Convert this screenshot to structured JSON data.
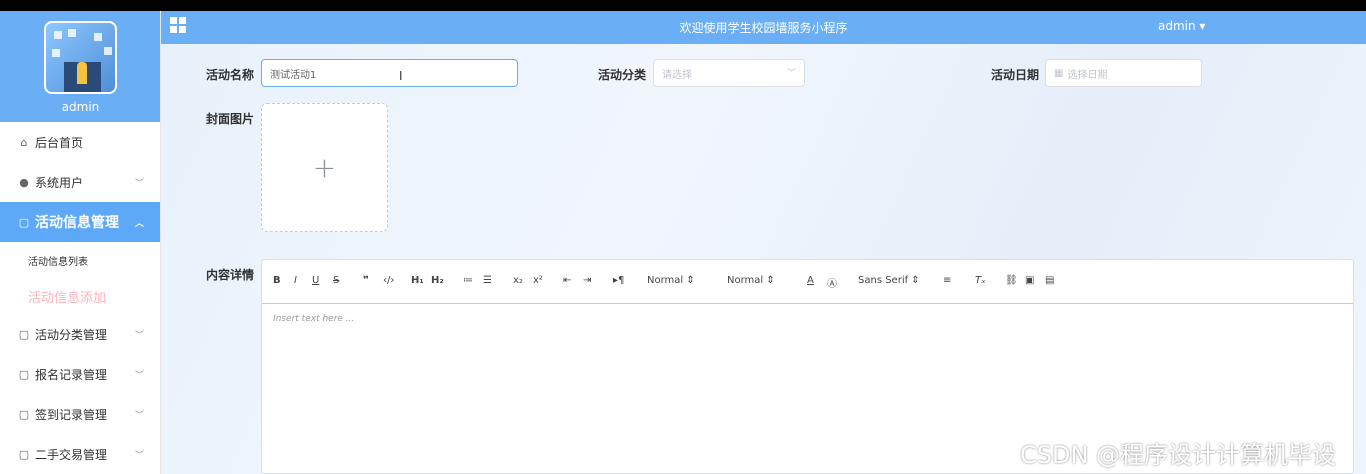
{
  "header": {
    "title": "欢迎使用学生校园墙服务小程序",
    "admin": "admin ▾"
  },
  "profile": {
    "name": "admin"
  },
  "sidebar": {
    "items": [
      {
        "label": "后台首页",
        "icon": "home-icon"
      },
      {
        "label": "系统用户",
        "icon": "user-icon"
      },
      {
        "label": "活动信息管理",
        "icon": "doc-icon",
        "active": true
      },
      {
        "label": "活动分类管理",
        "icon": "doc-icon"
      },
      {
        "label": "报名记录管理",
        "icon": "doc-icon"
      },
      {
        "label": "签到记录管理",
        "icon": "doc-icon"
      },
      {
        "label": "二手交易管理",
        "icon": "doc-icon"
      }
    ],
    "subitems": [
      {
        "label": "活动信息列表"
      },
      {
        "label": "活动信息添加",
        "current": true
      }
    ]
  },
  "form": {
    "name_label": "活动名称",
    "name_value": "测试活动1",
    "category_label": "活动分类",
    "category_placeholder": "请选择",
    "date_label": "活动日期",
    "date_placeholder": "选择日期",
    "cover_label": "封面图片",
    "content_label": "内容详情"
  },
  "editor": {
    "placeholder": "Insert text here ...",
    "size1": "Normal",
    "size2": "Normal",
    "font": "Sans Serif"
  },
  "watermark": "CSDN @程序设计计算机毕设"
}
